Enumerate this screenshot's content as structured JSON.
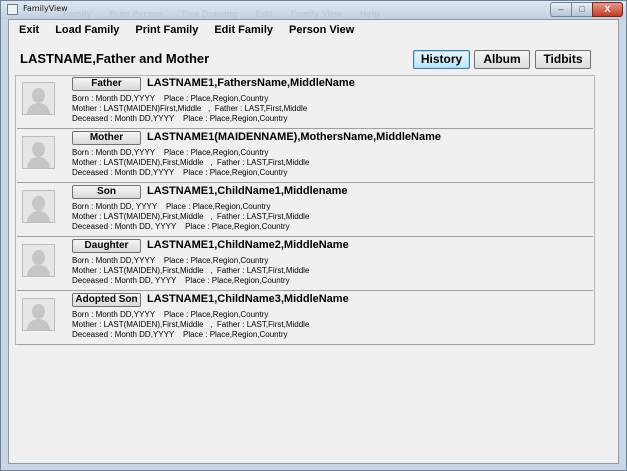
{
  "window": {
    "title": "FamilyView"
  },
  "ghost_menu": [
    "Family",
    "Print Person",
    "Tree Drawing",
    "Edit",
    "Family View",
    "Help"
  ],
  "titlebar_controls": {
    "minimize": "–",
    "maximize": "□",
    "close": "X"
  },
  "menu": [
    {
      "label": "Exit"
    },
    {
      "label": "Load Family"
    },
    {
      "label": "Print Family"
    },
    {
      "label": "Edit Family"
    },
    {
      "label": "Person View"
    }
  ],
  "header": {
    "title": "LASTNAME,Father and Mother",
    "buttons": {
      "history": "History",
      "album": "Album",
      "tidbits": "Tidbits"
    }
  },
  "people": [
    {
      "role": "Father",
      "name": "LASTNAME1,FathersName,MiddleName",
      "born": "Born : Month DD,YYYY    Place : Place,Region,Country",
      "parents": "Mother : LAST(MAIDEN)First,Middle   ,  Father : LAST,First,Middle",
      "deceased": "Deceased : Month DD,YYYY    Place : Place,Region,Country"
    },
    {
      "role": "Mother",
      "name": "LASTNAME1(MAIDENNAME),MothersName,MiddleName",
      "born": "Born : Month DD,YYYY    Place : Place,Region,Country",
      "parents": "Mother : LAST(MAIDEN),First,Middle   ,  Father : LAST,First,Middle",
      "deceased": "Deceased : Month DD,YYYY    Place : Place,Region,Country"
    },
    {
      "role": "Son",
      "name": "LASTNAME1,ChildName1,Middlename",
      "born": "Born : Month DD, YYYY    Place : Place,Region,Country",
      "parents": "Mother : LAST(MAIDEN),First,Middle   ,  Father : LAST,First,Middle",
      "deceased": "Deceased : Month DD, YYYY    Place : Place,Region,Country"
    },
    {
      "role": "Daughter",
      "name": "LASTNAME1,ChildName2,MiddleName",
      "born": "Born : Month DD,YYYY    Place : Place,Region,Country",
      "parents": "Mother : LAST(MAIDEN),First,Middle   ,  Father : LAST,First,Middle",
      "deceased": "Deceased : Month DD, YYYY    Place : Place,Region,Country"
    },
    {
      "role": "Adopted Son",
      "name": "LASTNAME1,ChildName3,MiddleName",
      "born": "Born : Month DD,YYYY    Place : Place,Region,Country",
      "parents": "Mother : LAST(MAIDEN),First,Middle   ,  Father : LAST,First,Middle",
      "deceased": "Deceased : Month DD,YYYY    Place : Place,Region,Country"
    }
  ]
}
